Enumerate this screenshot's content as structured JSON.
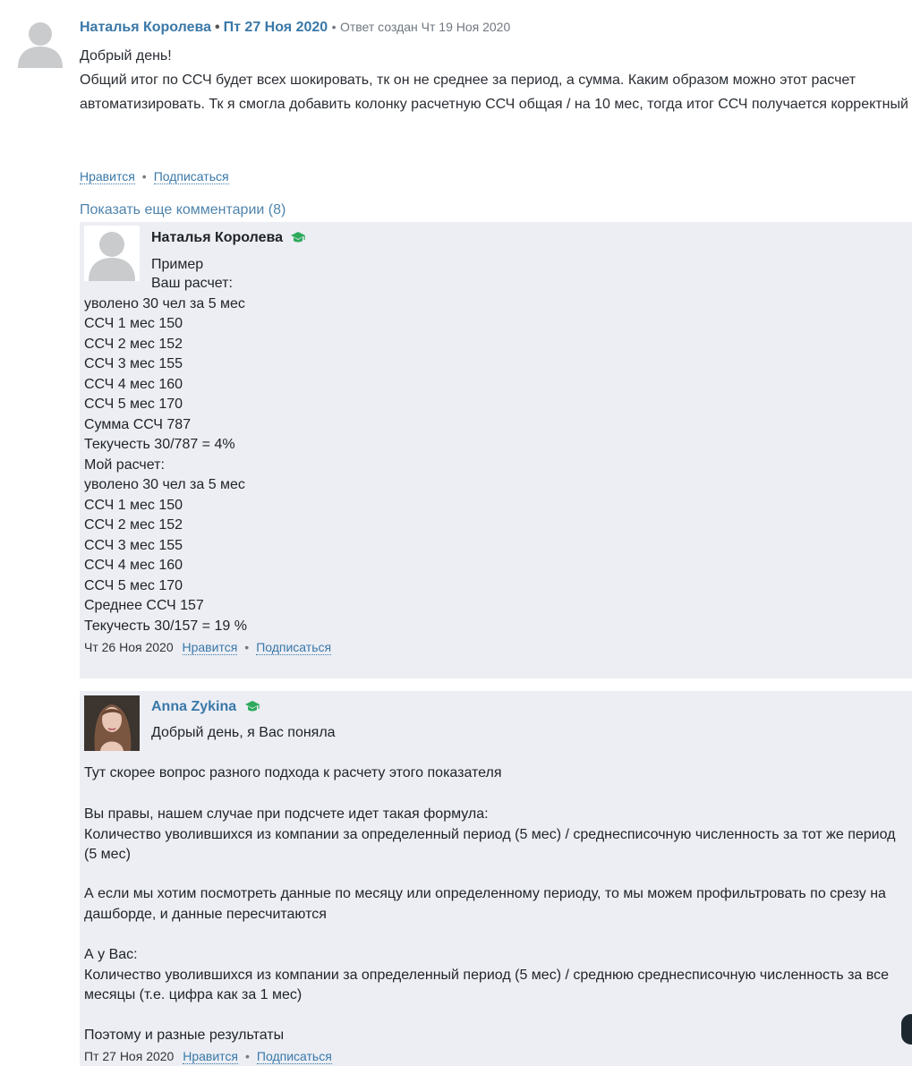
{
  "top_comment": {
    "author": "Наталья Королева",
    "date": "Пт 27 Ноя 2020",
    "created_note": "Ответ создан Чт 19 Ноя 2020",
    "body": [
      "Добрый день!",
      "Общий итог по ССЧ будет всех шокировать, тк он не среднее за период, а сумма. Каким образом можно этот расчет автоматизировать. Тк я смогла добавить колонку расчетную ССЧ общая / на 10 мес, тогда итог ССЧ получается корректный"
    ],
    "like_label": "Нравится",
    "subscribe_label": "Подписаться"
  },
  "show_more_label": "Показать еще комментарии (8)",
  "reply1": {
    "author": "Наталья Королева",
    "badge_icon": "graduation-cap-icon",
    "first_line": "Пример",
    "lines": [
      "Ваш расчет:",
      "уволено 30 чел за 5 мес",
      "ССЧ 1 мес 150",
      "ССЧ 2 мес 152",
      "ССЧ 3 мес 155",
      "ССЧ 4 мес 160",
      "ССЧ 5 мес 170",
      "Сумма ССЧ 787",
      "Текучесть 30/787 = 4%",
      "Мой расчет:",
      "уволено 30 чел за 5 мес",
      "ССЧ 1 мес 150",
      "ССЧ 2 мес 152",
      "ССЧ 3 мес 155",
      "ССЧ 4 мес 160",
      "ССЧ 5 мес 170",
      "Среднее ССЧ 157",
      "Текучесть 30/157 = 19 %"
    ],
    "date": "Чт 26 Ноя 2020",
    "like_label": "Нравится",
    "subscribe_label": "Подписаться"
  },
  "reply2": {
    "author": "Anna Zykina",
    "badge_icon": "graduation-cap-icon",
    "first_line": "Добрый день, я Вас поняла",
    "paragraphs": [
      [
        "Тут скорее вопрос разного подхода к расчету этого показателя"
      ],
      [
        "Вы правы, нашем случае при подсчете идет такая формула:",
        "Количество уволившихся из компании за определенный период (5 мес) / среднесписочную численность за тот же период (5 мес)"
      ],
      [
        "А если мы хотим посмотреть данные по месяцу или определенному периоду, то мы можем профильтровать по срезу на дашборде, и данные пересчитаются"
      ],
      [
        "А у Вас:",
        "Количество уволившихся из компании за определенный период (5 мес) / среднюю среднесписочную численность за все месяцы (т.е. цифра как за 1 мес)"
      ],
      [
        "Поэтому и разные результаты"
      ]
    ],
    "date": "Пт 27 Ноя 2020",
    "like_label": "Нравится",
    "subscribe_label": "Подписаться"
  },
  "colors": {
    "link": "#3a78a8",
    "reply_background": "#eceef4",
    "badge": "#2eaa5c"
  }
}
